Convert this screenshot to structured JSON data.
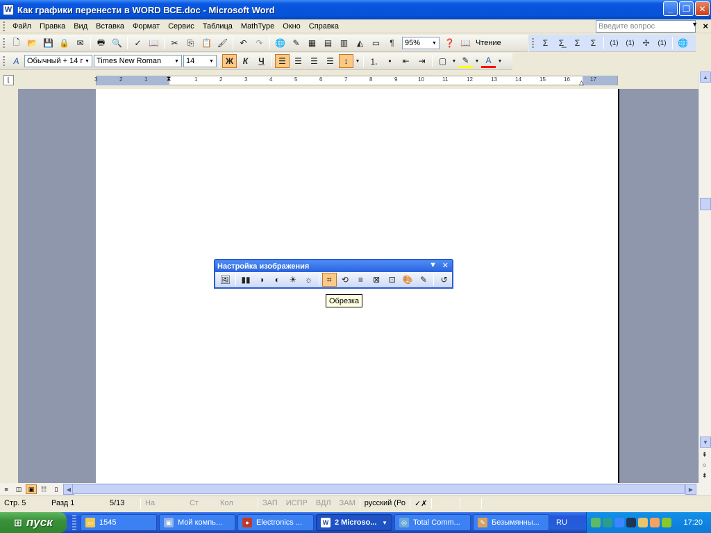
{
  "window": {
    "title": "Как графики перенести в WORD ВСЕ.doc - Microsoft Word",
    "app_icon": "W"
  },
  "menubar": {
    "items": [
      "Файл",
      "Правка",
      "Вид",
      "Вставка",
      "Формат",
      "Сервис",
      "Таблица",
      "MathType",
      "Окно",
      "Справка"
    ],
    "ask_placeholder": "Введите вопрос"
  },
  "toolbar_standard": {
    "zoom": "95%",
    "reading_label": "Чтение"
  },
  "toolbar_formatting": {
    "style": "Обычный + 14 г",
    "font": "Times New Roman",
    "size": "14"
  },
  "mathtype_toolbar": {
    "labels": [
      "(1)",
      "(1)",
      "(1)"
    ]
  },
  "ruler": {
    "numbers": [
      "3",
      "2",
      "1",
      "1",
      "2",
      "3",
      "4",
      "5",
      "6",
      "7",
      "8",
      "9",
      "10",
      "11",
      "12",
      "13",
      "14",
      "15",
      "16",
      "17"
    ]
  },
  "picture_toolbar": {
    "title": "Настройка изображения",
    "tooltip": "Обрезка"
  },
  "statusbar": {
    "page": "Стр.  5",
    "section": "Разд  1",
    "pages": "5/13",
    "at": "На",
    "line": "Ст",
    "col": "Кол",
    "rec": "ЗАП",
    "trk": "ИСПР",
    "ext": "ВДЛ",
    "ovr": "ЗАМ",
    "language": "русский (Ро"
  },
  "taskbar": {
    "start_label": "пуск",
    "tasks": [
      {
        "label": "1545",
        "active": false
      },
      {
        "label": "Мой компь...",
        "active": false
      },
      {
        "label": "Electronics ...",
        "active": false
      },
      {
        "label": "2 Microso...",
        "active": true
      },
      {
        "label": "Total Comm...",
        "active": false
      },
      {
        "label": "Безымянны...",
        "active": false
      }
    ],
    "language": "RU",
    "clock": "17:20"
  },
  "colors": {
    "accent": "#0553D8",
    "doc_bg": "#8E97AC",
    "button_pressed": "#FCC985"
  }
}
